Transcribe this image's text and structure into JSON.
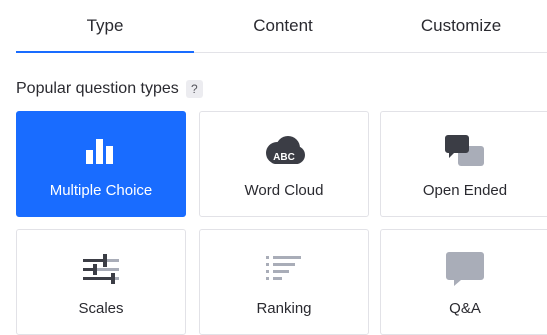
{
  "tabs": [
    {
      "label": "Type",
      "active": true
    },
    {
      "label": "Content",
      "active": false
    },
    {
      "label": "Customize",
      "active": false
    }
  ],
  "section": {
    "title": "Popular question types",
    "help": "?"
  },
  "question_types": [
    {
      "label": "Multiple Choice",
      "icon": "bar-chart-icon",
      "selected": true
    },
    {
      "label": "Word Cloud",
      "icon": "word-cloud-icon",
      "badge": "ABC",
      "selected": false
    },
    {
      "label": "Open Ended",
      "icon": "speech-bubbles-icon",
      "selected": false
    },
    {
      "label": "Scales",
      "icon": "sliders-icon",
      "selected": false
    },
    {
      "label": "Ranking",
      "icon": "ranking-list-icon",
      "selected": false
    },
    {
      "label": "Q&A",
      "icon": "chat-bubble-icon",
      "selected": false
    }
  ],
  "colors": {
    "accent": "#196cff",
    "icon_dark": "#3b3d45",
    "icon_gray": "#a9adb8"
  }
}
